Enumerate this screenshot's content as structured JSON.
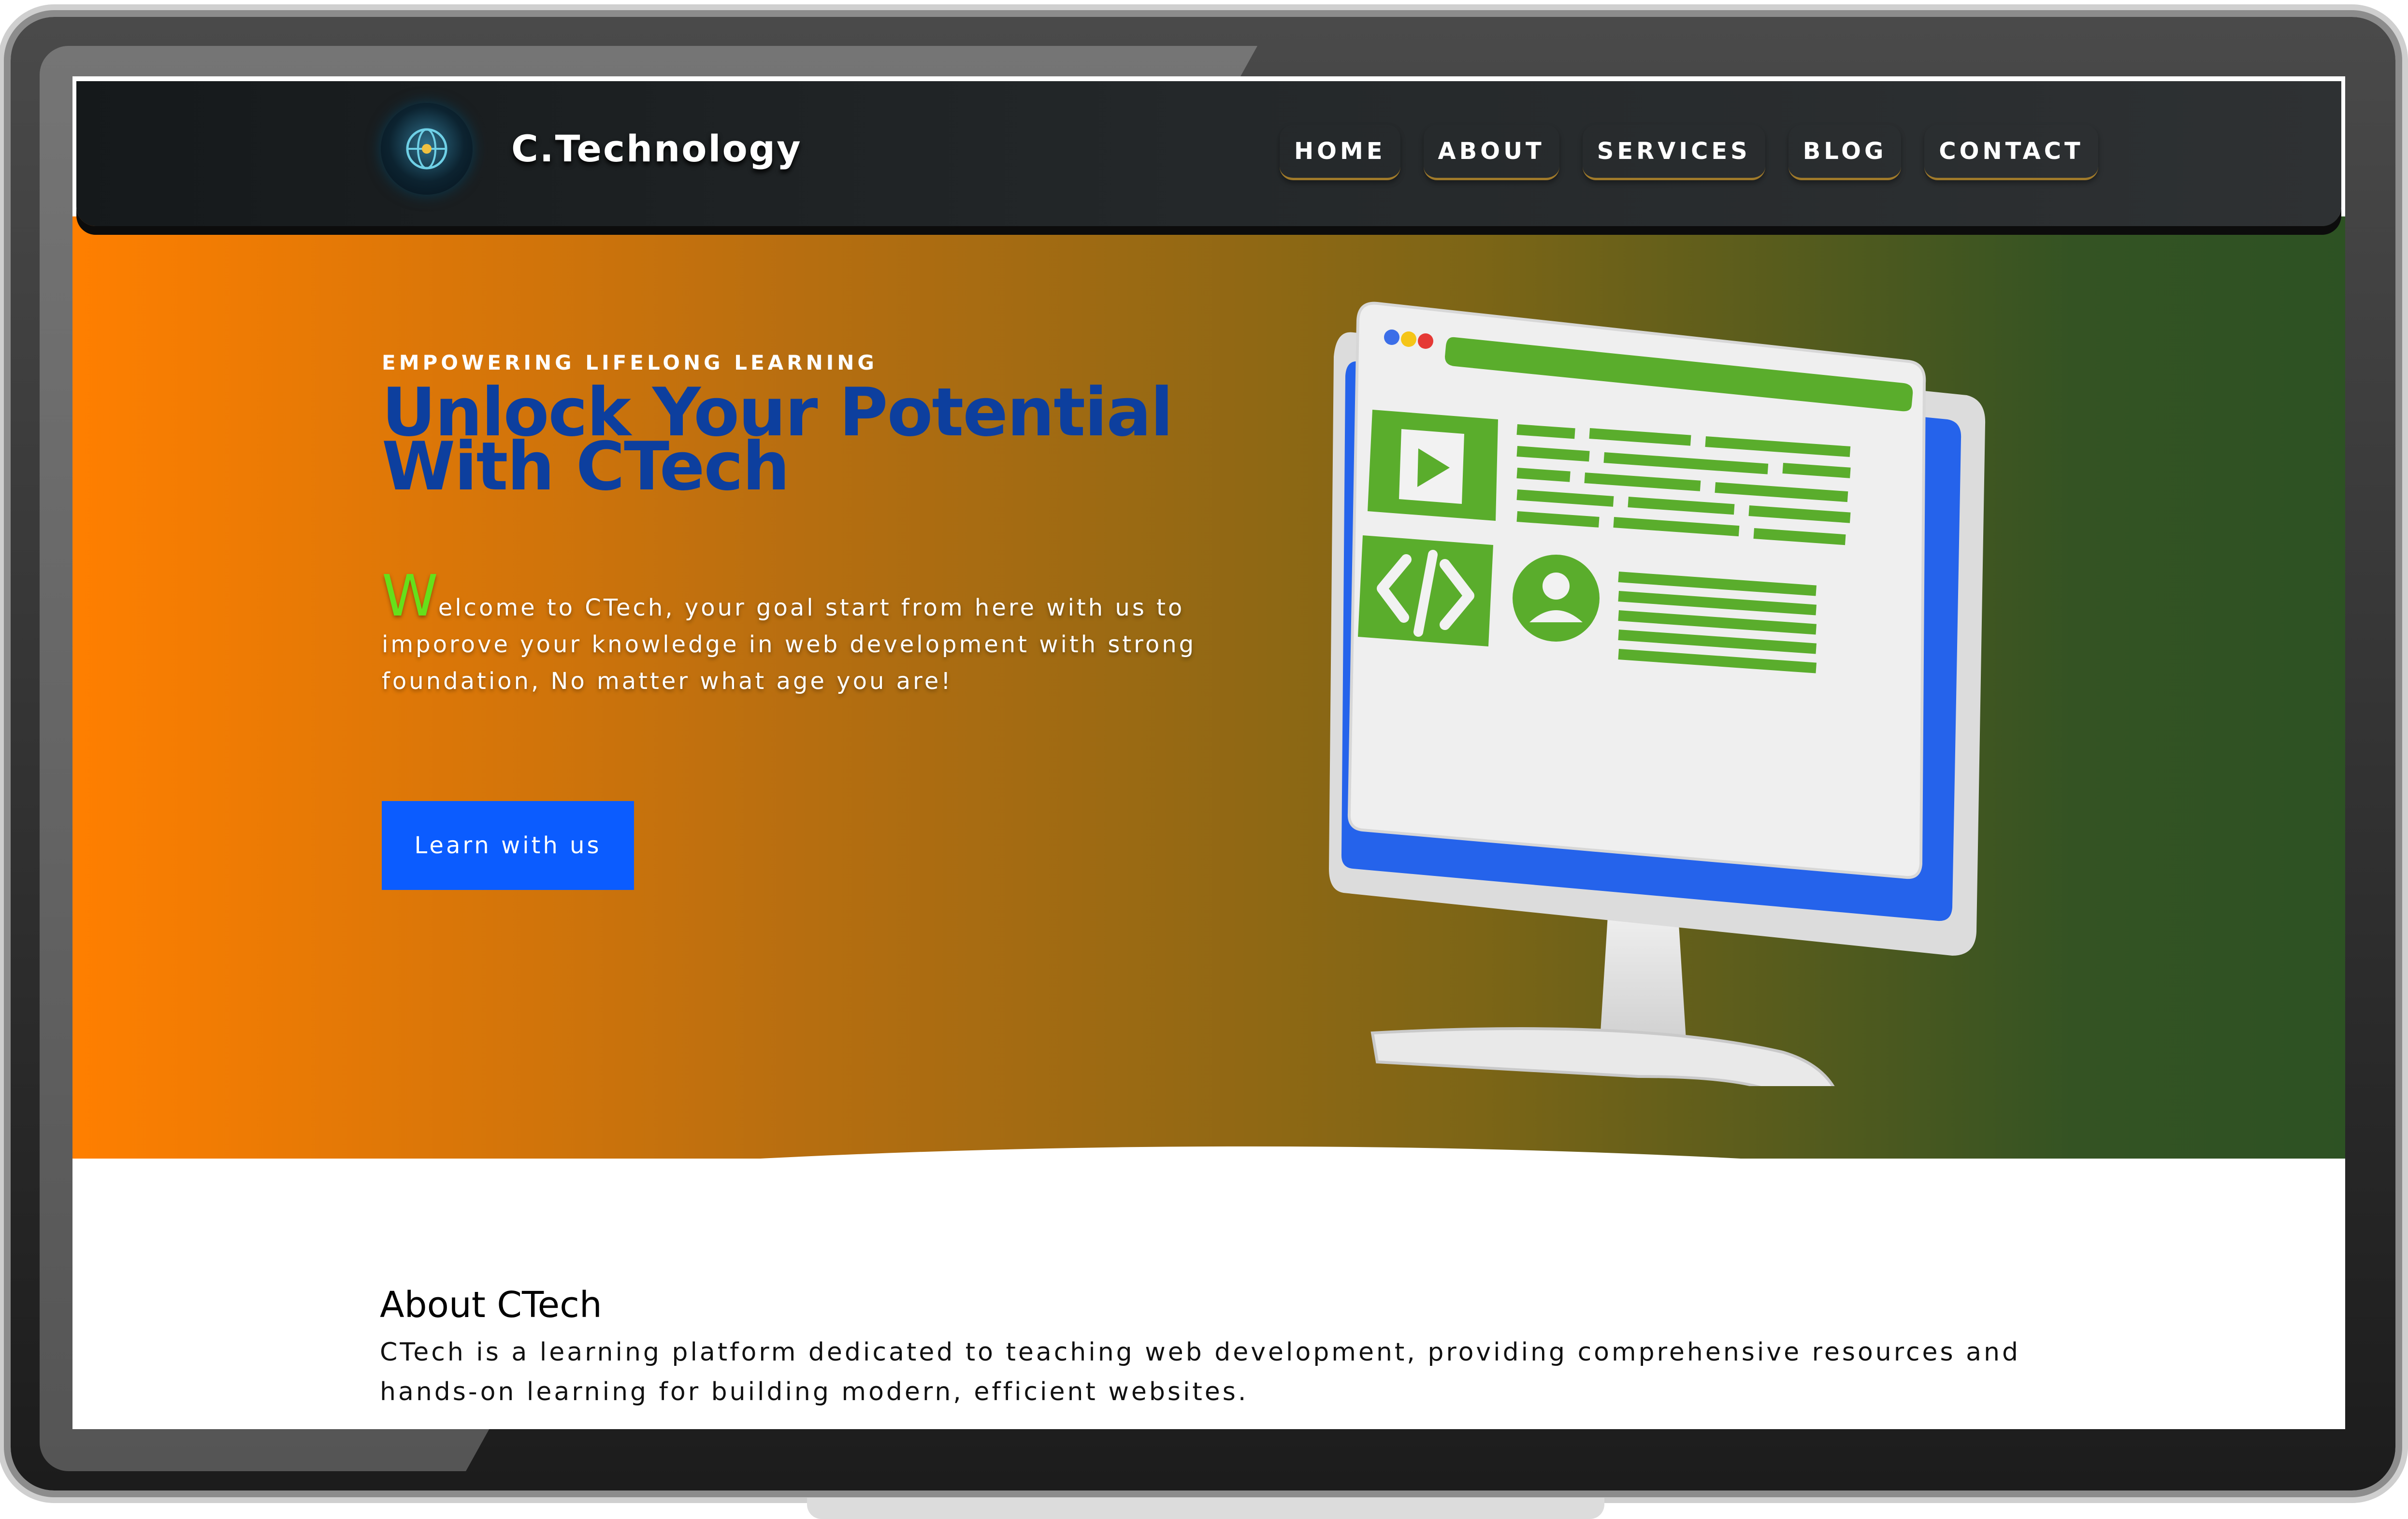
{
  "brand": {
    "name": "C.Technology",
    "logo_icon": "globe-emblem-icon"
  },
  "nav": {
    "items": [
      {
        "label": "HOME"
      },
      {
        "label": "ABOUT"
      },
      {
        "label": "SERVICES"
      },
      {
        "label": "BLOG"
      },
      {
        "label": "CONTACT"
      }
    ]
  },
  "hero": {
    "eyebrow": "EMPOWERING LIFELONG LEARNING",
    "title_line1": "Unlock Your Potential",
    "title_line2": "With CTech",
    "intro_first_letter": "W",
    "intro_rest": "elcome to CTech, your goal start from here with us to imporove your knowledge in web development with strong foundation, No matter what age you are!",
    "cta_label": "Learn with us",
    "illustration": "web-development-monitor-icon"
  },
  "about": {
    "title": "About CTech",
    "text": "CTech is a learning platform dedicated to teaching web development, providing comprehensive resources and hands-on learning for building modern, efficient websites."
  },
  "colors": {
    "accent_blue": "#0b5cff",
    "headline_blue": "#0d3f9e",
    "hero_orange": "#ff7f00",
    "hero_green": "#2d5223",
    "dropcap_green": "#66e01a",
    "illustration_green": "#5aad2c"
  }
}
